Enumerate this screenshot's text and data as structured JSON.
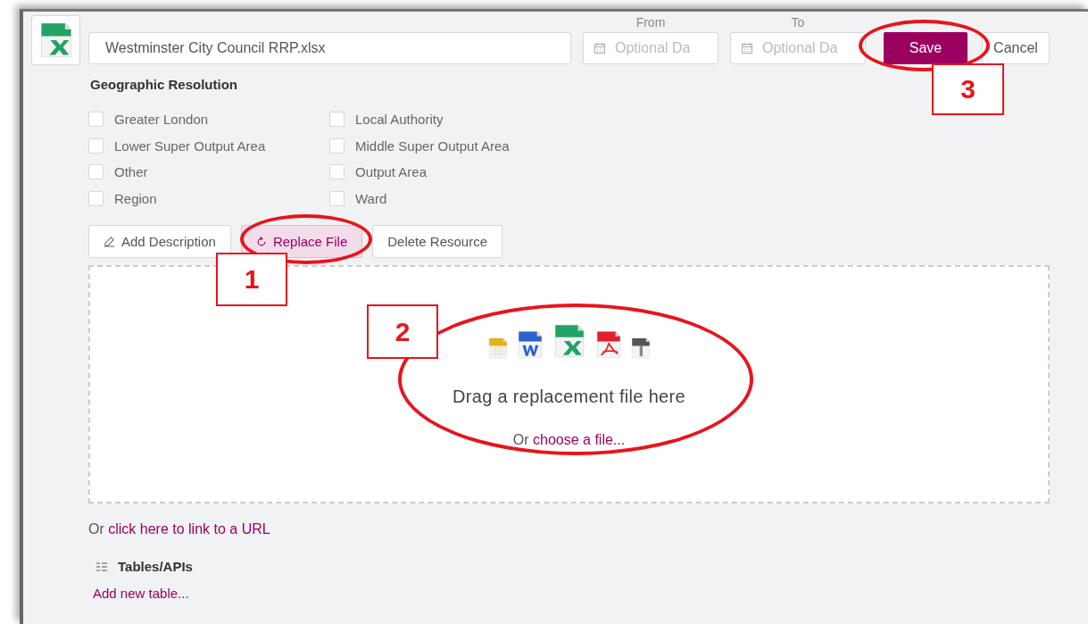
{
  "resource": {
    "file_name": "Westminster City Council RRP.xlsx",
    "date_range": [
      {
        "label": "From",
        "placeholder": "Optional Da"
      },
      {
        "label": "To",
        "placeholder": "Optional Da"
      }
    ],
    "save_button": "Save",
    "cancel_button": "Cancel"
  },
  "geographic_resolution": {
    "title": "Geographic Resolution",
    "options": [
      {
        "label": "Greater London",
        "checked": false
      },
      {
        "label": "Lower Super Output Area",
        "checked": false
      },
      {
        "label": "Other",
        "checked": false
      },
      {
        "label": "Region",
        "checked": false
      },
      {
        "label": "Local Authority",
        "checked": false
      },
      {
        "label": "Middle Super Output Area",
        "checked": false
      },
      {
        "label": "Output Area",
        "checked": false
      },
      {
        "label": "Ward",
        "checked": false
      }
    ]
  },
  "actions": [
    {
      "label": "Add Description",
      "kind": "edit",
      "selected": false
    },
    {
      "label": "Replace File",
      "kind": "replace",
      "selected": true
    },
    {
      "label": "Delete Resource",
      "kind": "plain",
      "selected": false
    }
  ],
  "drop_zone": {
    "title": "Drag a replacement file here",
    "prefix": "Or",
    "link": "choose a file..."
  },
  "url_link": {
    "prefix": "Or",
    "link": "click here to link to a URL"
  },
  "tables": {
    "title": "Tables/APIs",
    "add_link": "Add new table..."
  },
  "annotations": [
    {
      "label": "1"
    },
    {
      "label": "2"
    },
    {
      "label": "3"
    }
  ]
}
